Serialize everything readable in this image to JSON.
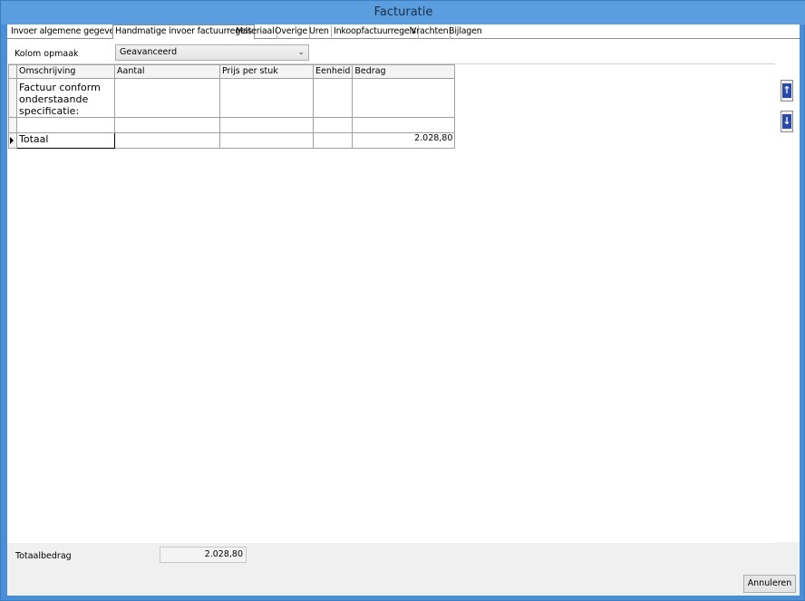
{
  "window": {
    "title": "Facturatie"
  },
  "tabs": [
    {
      "label": "Invoer algemene gegevens"
    },
    {
      "label": "Handmatige invoer factuurregels"
    },
    {
      "label": "Materiaal"
    },
    {
      "label": "Overige"
    },
    {
      "label": "Uren"
    },
    {
      "label": "Inkoopfactuurregels"
    },
    {
      "label": "Vrachten"
    },
    {
      "label": "Bijlagen"
    }
  ],
  "active_tab": "Handmatige invoer factuurregels",
  "kolom_opmaak": {
    "label": "Kolom opmaak",
    "value": "Geavanceerd"
  },
  "grid": {
    "columns": [
      "Omschrijving",
      "Aantal",
      "Prijs per stuk",
      "Eenheid",
      "Bedrag"
    ],
    "rows": [
      {
        "omschrijving": "Factuur conform onderstaande specificatie:",
        "aantal": "",
        "prijs": "",
        "eenheid": "",
        "bedrag": ""
      },
      {
        "omschrijving": "",
        "aantal": "",
        "prijs": "",
        "eenheid": "",
        "bedrag": ""
      }
    ],
    "total_row": {
      "omschrijving": "Totaal",
      "bedrag": "2.028,80"
    }
  },
  "footer": {
    "totaal_label": "Totaalbedrag",
    "totaal_value": "2.028,80",
    "cancel_label": "Annuleren"
  },
  "icons": {
    "move_up": "arrow-up-icon",
    "move_down": "arrow-down-icon"
  },
  "colors": {
    "titlebar": "#5b9ee0",
    "icon_blue": "#2a49a8"
  }
}
